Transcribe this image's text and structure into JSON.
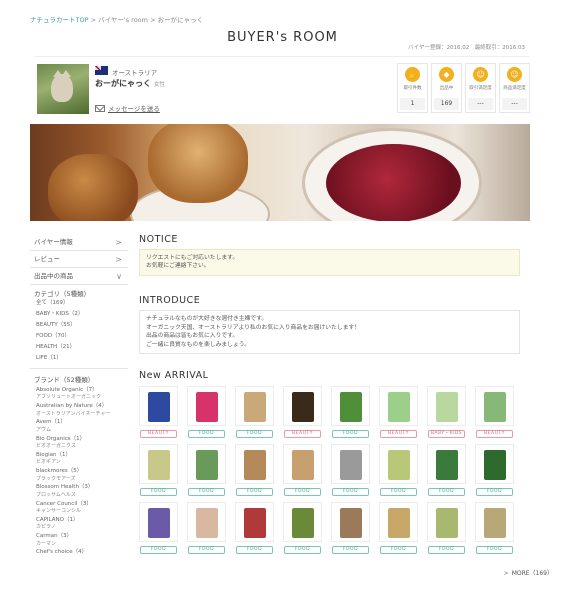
{
  "breadcrumb": {
    "home": "ナチュラカートTOP",
    "sep1": ">",
    "room": "バイヤー's room",
    "sep2": ">",
    "current": "おーがにゃっく"
  },
  "page_title": "BUYER's ROOM",
  "meta": {
    "registered": "バイヤー登録：2016.02　最終取引：2016.03"
  },
  "profile": {
    "country": "オーストラリア",
    "name": "おーがにゃっく",
    "gender": "女性",
    "message_link": "メッセージを送る",
    "stats": [
      {
        "label": "取引件数",
        "value": "1",
        "icon": "handshake-icon",
        "glyph": "✋"
      },
      {
        "label": "出品中",
        "value": "169",
        "icon": "tag-icon",
        "glyph": "◆"
      },
      {
        "label": "取引満足度",
        "value": "---",
        "icon": "smile-icon",
        "glyph": "☺"
      },
      {
        "label": "商品満足度",
        "value": "---",
        "icon": "smile-icon",
        "glyph": "☺"
      }
    ]
  },
  "sidebar": {
    "items": [
      {
        "label": "バイヤー情報",
        "chevron": ">"
      },
      {
        "label": "レビュー",
        "chevron": ">"
      },
      {
        "label": "出品中の商品",
        "chevron": "∨"
      }
    ],
    "category_title": "カテゴリ（5種類）",
    "categories": [
      "全て（169）",
      "BABY・KIDS（2）",
      "BEAUTY（55）",
      "FOOD（70）",
      "HEALTH（21）",
      "LIFE（1）"
    ],
    "brand_title": "ブランド（52種類）",
    "brands": [
      {
        "en": "Absolute Organic（7）",
        "jp": "アブソリュートオーガニック"
      },
      {
        "en": "Australian by Nature（4）",
        "jp": "オーストラリアンバイネーチャー"
      },
      {
        "en": "Avem（1）",
        "jp": "アヴム"
      },
      {
        "en": "Bio Organics（1）",
        "jp": "ビオオーガニクス"
      },
      {
        "en": "Biogian（1）",
        "jp": "ビオギアン"
      },
      {
        "en": "blackmores（5）",
        "jp": "ブラックモアーズ"
      },
      {
        "en": "Blossom Health（3）",
        "jp": "ブロッサムヘルス"
      },
      {
        "en": "Cancer Council（3）",
        "jp": "キャンサーコンシル"
      },
      {
        "en": "CAPILANO（1）",
        "jp": "カピラノ"
      },
      {
        "en": "Carman（3）",
        "jp": "カーマン"
      },
      {
        "en": "Chef's choice（4）",
        "jp": ""
      }
    ]
  },
  "notice": {
    "title": "NOTICE",
    "lines": [
      "リクエストにもご対応いたします。",
      "お気軽にご連絡下さい。"
    ]
  },
  "introduce": {
    "title": "INTRODUCE",
    "lines": [
      "ナチュラルなものが大好きな週付き主婦です。",
      "オーガニック天国、オーストラリアより私のお気に入り商品をお届けいたします！",
      "出品の商品は皆もお気に入りです。",
      "ご一緒に良質なものを楽しみましょう。"
    ]
  },
  "arrival": {
    "title": "New ARRIVAL",
    "products": [
      {
        "tag": "BEAUTY",
        "kind": "beauty",
        "color": "#2e4aa0"
      },
      {
        "tag": "FOOD",
        "kind": "food",
        "color": "#d8326a"
      },
      {
        "tag": "FOOD",
        "kind": "food",
        "color": "#c9a87a"
      },
      {
        "tag": "BEAUTY",
        "kind": "beauty",
        "color": "#3a2a1a"
      },
      {
        "tag": "FOOD",
        "kind": "food",
        "color": "#4f8f3a"
      },
      {
        "tag": "BEAUTY",
        "kind": "beauty",
        "color": "#9ccf8a"
      },
      {
        "tag": "BABY・KIDS",
        "kind": "beauty",
        "color": "#b8d8a0"
      },
      {
        "tag": "BEAUTY",
        "kind": "beauty",
        "color": "#88b878"
      },
      {
        "tag": "FOOD",
        "kind": "food",
        "color": "#c8c88a"
      },
      {
        "tag": "FOOD",
        "kind": "food",
        "color": "#6a9a5a"
      },
      {
        "tag": "FOOD",
        "kind": "food",
        "color": "#b58a5a"
      },
      {
        "tag": "FOOD",
        "kind": "food",
        "color": "#c8a070"
      },
      {
        "tag": "FOOD",
        "kind": "food",
        "color": "#9a9a9a"
      },
      {
        "tag": "FOOD",
        "kind": "food",
        "color": "#b8c878"
      },
      {
        "tag": "FOOD",
        "kind": "food",
        "color": "#3a7a3a"
      },
      {
        "tag": "FOOD",
        "kind": "food",
        "color": "#2e6a2e"
      },
      {
        "tag": "FOOD",
        "kind": "food",
        "color": "#6a5aa8"
      },
      {
        "tag": "FOOD",
        "kind": "food",
        "color": "#d8b8a0"
      },
      {
        "tag": "FOOD",
        "kind": "food",
        "color": "#b03a3a"
      },
      {
        "tag": "FOOD",
        "kind": "food",
        "color": "#6a8a3a"
      },
      {
        "tag": "FOOD",
        "kind": "food",
        "color": "#9a7a5a"
      },
      {
        "tag": "FOOD",
        "kind": "food",
        "color": "#c8a868"
      },
      {
        "tag": "FOOD",
        "kind": "food",
        "color": "#a8b870"
      },
      {
        "tag": "FOOD",
        "kind": "food",
        "color": "#b8a878"
      }
    ],
    "more": "MORE（169）"
  }
}
